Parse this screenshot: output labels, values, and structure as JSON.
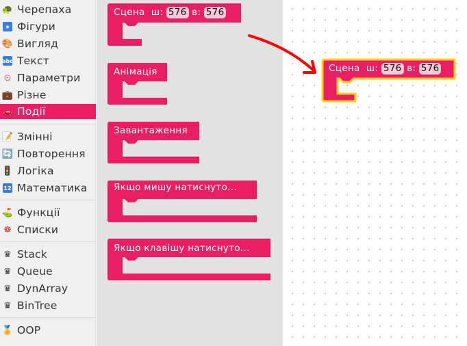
{
  "sidebar": {
    "items": [
      {
        "label": "Черепаха",
        "icon": "turtle-icon"
      },
      {
        "label": "Фігури",
        "icon": "shapes-icon"
      },
      {
        "label": "Вигляд",
        "icon": "palette-icon"
      },
      {
        "label": "Текст",
        "icon": "abc-text-icon"
      },
      {
        "label": "Параметри",
        "icon": "clock-icon"
      },
      {
        "label": "Різне",
        "icon": "briefcase-icon"
      },
      {
        "label": "Події",
        "icon": "car-icon",
        "active": true
      },
      {
        "label": "Змінні",
        "icon": "memo-icon"
      },
      {
        "label": "Повторення",
        "icon": "cycle-icon"
      },
      {
        "label": "Логіка",
        "icon": "traffic-light-icon"
      },
      {
        "label": "Математика",
        "icon": "numbers-icon"
      },
      {
        "label": "Функції",
        "icon": "golf-flag-icon"
      },
      {
        "label": "Списки",
        "icon": "wheel-icon"
      },
      {
        "label": "Stack",
        "icon": "crown-icon"
      },
      {
        "label": "Queue",
        "icon": "crown-icon"
      },
      {
        "label": "DynArray",
        "icon": "crown-icon"
      },
      {
        "label": "BinTree",
        "icon": "crown-icon"
      },
      {
        "label": "OOP",
        "icon": "medal-icon"
      }
    ]
  },
  "flyout": {
    "blocks": [
      {
        "label": "Сцена",
        "w_label": "ш:",
        "w_value": "576",
        "h_label": "в:",
        "h_value": "576"
      },
      {
        "label": "Анімація"
      },
      {
        "label": "Завантаження"
      },
      {
        "label": "Якщо  мишу  натиснуто..."
      },
      {
        "label": "Якщо  клавішу  натиснуто..."
      }
    ]
  },
  "workspace": {
    "block": {
      "label": "Сцена",
      "w_label": "ш:",
      "w_value": "576",
      "h_label": "в:",
      "h_value": "576"
    }
  },
  "colors": {
    "block": "#e91e63",
    "highlight": "#fcd116",
    "active_category": "#e91e63",
    "arrow": "#ff0000"
  }
}
